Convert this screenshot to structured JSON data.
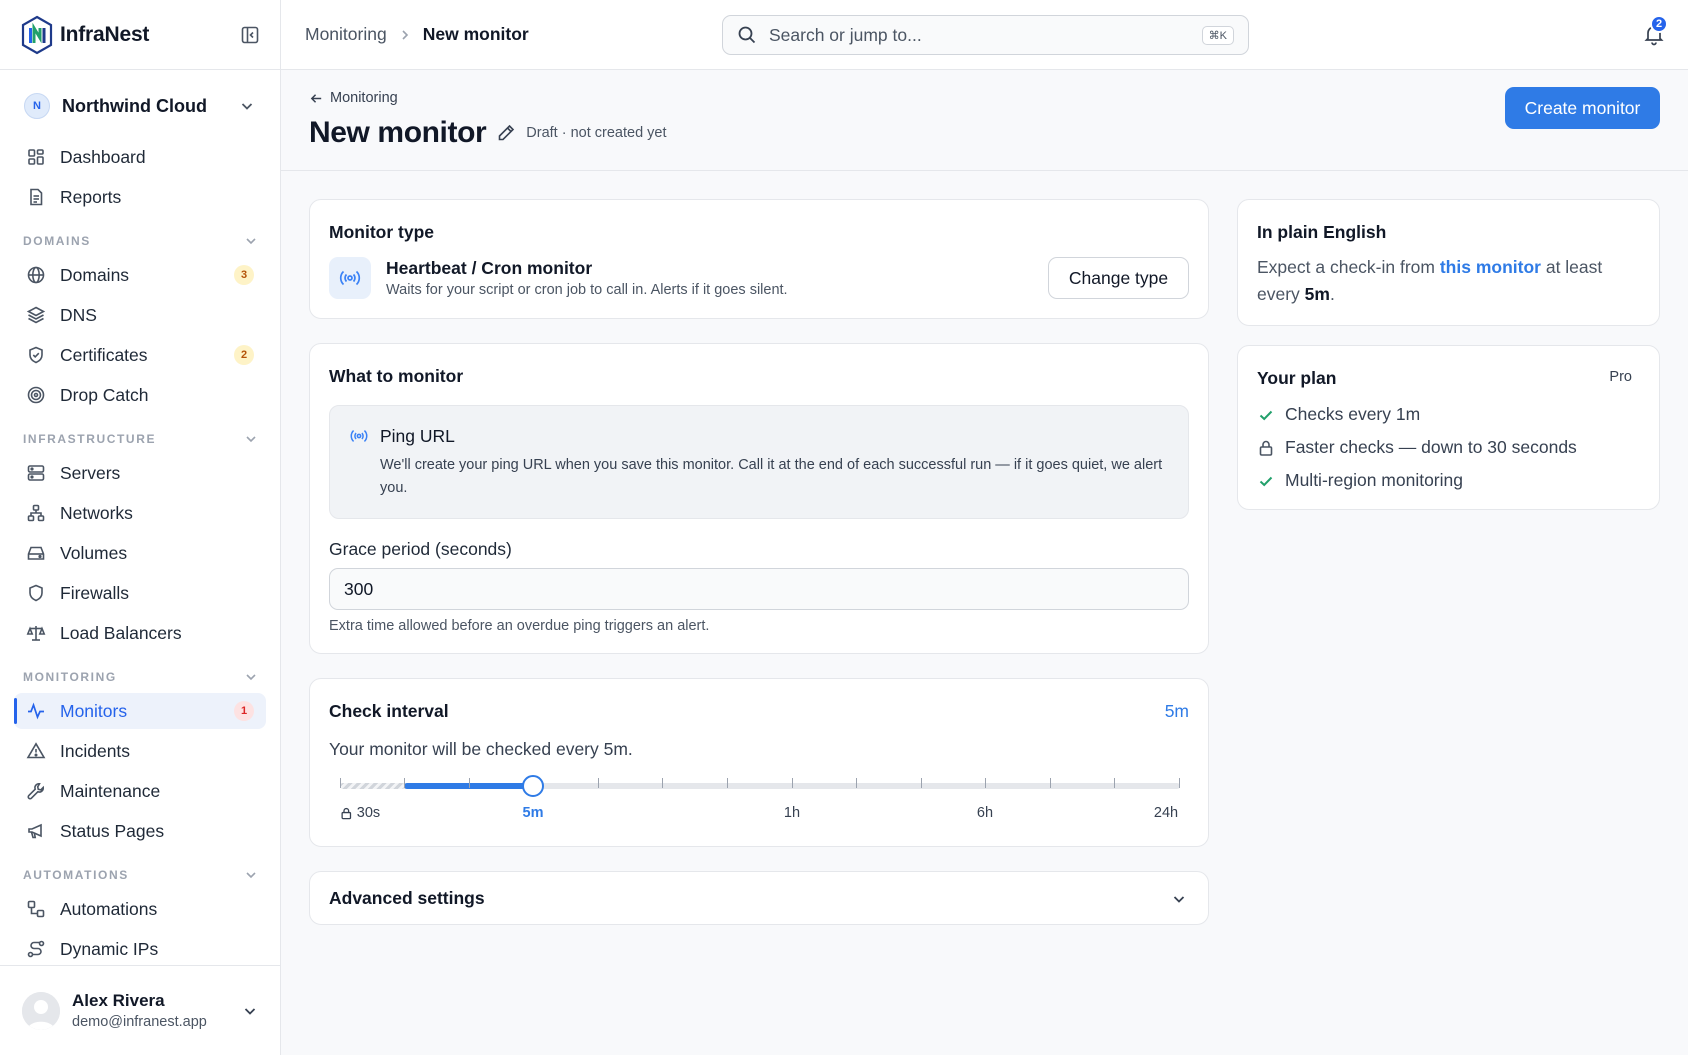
{
  "brand": {
    "name": "InfraNest"
  },
  "org": {
    "initial": "N",
    "name": "Northwind Cloud"
  },
  "nav": {
    "top": [
      {
        "label": "Dashboard"
      },
      {
        "label": "Reports"
      }
    ],
    "domains_section": "DOMAINS",
    "domains": [
      {
        "label": "Domains",
        "count": "3"
      },
      {
        "label": "DNS"
      },
      {
        "label": "Certificates",
        "count": "2"
      },
      {
        "label": "Drop Catch"
      }
    ],
    "infrastructure_section": "INFRASTRUCTURE",
    "infrastructure": [
      {
        "label": "Servers"
      },
      {
        "label": "Networks"
      },
      {
        "label": "Volumes"
      },
      {
        "label": "Firewalls"
      },
      {
        "label": "Load Balancers"
      }
    ],
    "monitoring_section": "MONITORING",
    "monitoring": [
      {
        "label": "Monitors",
        "count": "1",
        "active": true
      },
      {
        "label": "Incidents"
      },
      {
        "label": "Maintenance"
      },
      {
        "label": "Status Pages"
      }
    ],
    "automations_section": "AUTOMATIONS",
    "automations": [
      {
        "label": "Automations"
      },
      {
        "label": "Dynamic IPs"
      }
    ]
  },
  "user": {
    "name": "Alex Rivera",
    "email": "demo@infranest.app"
  },
  "topbar": {
    "breadcrumb_parent": "Monitoring",
    "breadcrumb_current": "New monitor",
    "search_placeholder": "Search or jump to...",
    "search_shortcut": "⌘K",
    "notification_count": "2"
  },
  "header": {
    "back_label": "Monitoring",
    "title": "New monitor",
    "status": "Draft · not created yet",
    "create_button": "Create monitor"
  },
  "monitor_type": {
    "title": "Monitor type",
    "name": "Heartbeat / Cron monitor",
    "description": "Waits for your script or cron job to call in. Alerts if it goes silent.",
    "change_button": "Change type"
  },
  "what_to_monitor": {
    "title": "What to monitor",
    "ping_title": "Ping URL",
    "ping_description": "We'll create your ping URL when you save this monitor. Call it at the end of each successful run — if it goes quiet, we alert you.",
    "grace_label": "Grace period (seconds)",
    "grace_value": "300",
    "grace_help": "Extra time allowed before an overdue ping triggers an alert."
  },
  "check_interval": {
    "title": "Check interval",
    "value": "5m",
    "description": "Your monitor will be checked every 5m.",
    "labels": [
      "30s",
      "5m",
      "1h",
      "6h",
      "24h"
    ],
    "selected": "5m",
    "locked_below": "1m"
  },
  "advanced": {
    "title": "Advanced settings"
  },
  "plain_english": {
    "title": "In plain English",
    "text_pre": "Expect a check-in from ",
    "link": "this monitor",
    "text_mid": " at least every ",
    "interval": "5m",
    "text_post": "."
  },
  "plan": {
    "title": "Your plan",
    "tier": "Pro",
    "features": [
      {
        "label": "Checks every 1m",
        "icon": "check-icon"
      },
      {
        "label": "Faster checks — down to 30 seconds",
        "icon": "lock-icon"
      },
      {
        "label": "Multi-region monitoring",
        "icon": "check-icon"
      }
    ]
  },
  "colors": {
    "accent": "#2f7be6",
    "badge_warning": "#fef3c7",
    "badge_danger": "#fde2e2"
  }
}
